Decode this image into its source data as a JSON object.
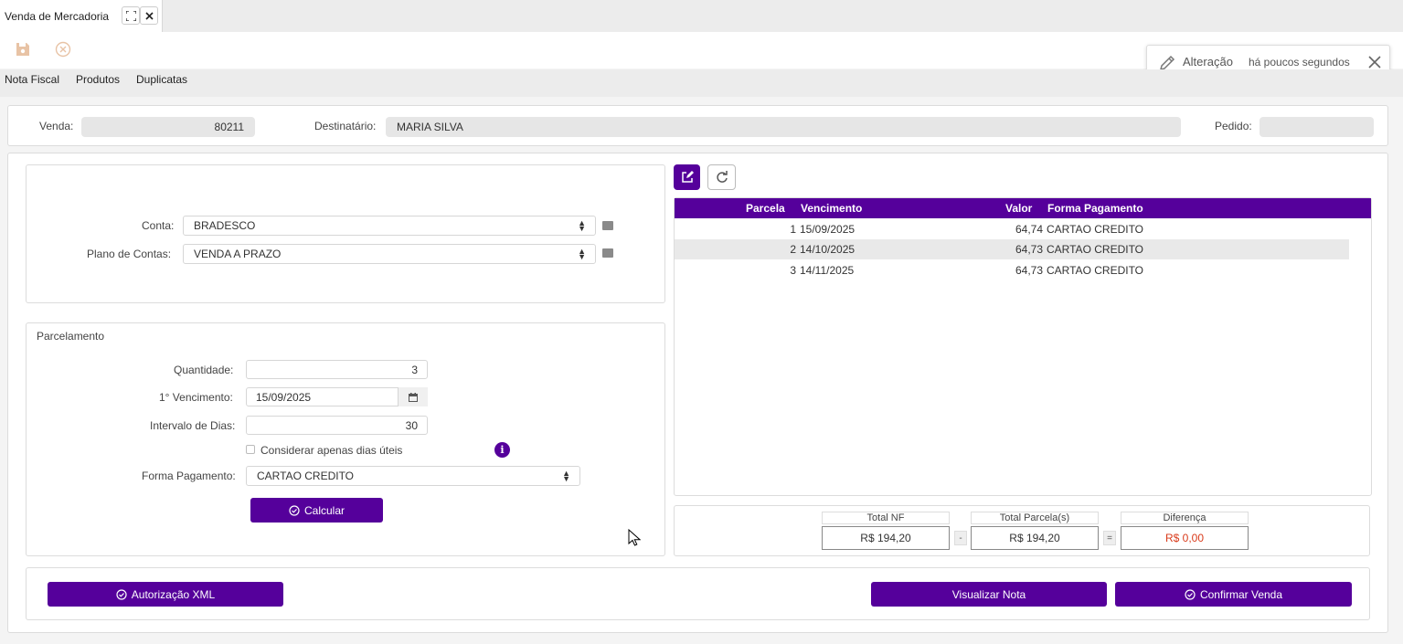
{
  "window": {
    "tab_title": "Venda de Mercadoria"
  },
  "toolbar": {
    "save_icon": "save-icon",
    "cancel_icon": "cancel-icon"
  },
  "menu": {
    "items": [
      "Nota Fiscal",
      "Produtos",
      "Duplicatas"
    ]
  },
  "toast": {
    "title": "Alteração",
    "subtitle": "há poucos segundos"
  },
  "header": {
    "venda_label": "Venda:",
    "venda_value": "80211",
    "destinatario_label": "Destinatário:",
    "destinatario_value": "MARIA SILVA",
    "pedido_label": "Pedido:",
    "pedido_value": ""
  },
  "account": {
    "conta_label": "Conta:",
    "conta_value": "BRADESCO",
    "plano_label": "Plano de Contas:",
    "plano_value": "VENDA A PRAZO"
  },
  "installments": {
    "section_title": "Parcelamento",
    "quantidade_label": "Quantidade:",
    "quantidade_value": "3",
    "vencimento_label": "1° Vencimento:",
    "vencimento_value": "15/09/2025",
    "intervalo_label": "Intervalo de Dias:",
    "intervalo_value": "30",
    "dias_uteis_label": "Considerar apenas dias úteis",
    "forma_label": "Forma Pagamento:",
    "forma_value": "CARTAO CREDITO",
    "calcular_label": "Calcular"
  },
  "grid": {
    "columns": [
      "Parcela",
      "Vencimento",
      "Valor",
      "Forma Pagamento"
    ],
    "rows": [
      {
        "parcela": "1",
        "vencimento": "15/09/2025",
        "valor": "64,74",
        "forma": "CARTAO CREDITO"
      },
      {
        "parcela": "2",
        "vencimento": "14/10/2025",
        "valor": "64,73",
        "forma": "CARTAO CREDITO"
      },
      {
        "parcela": "3",
        "vencimento": "14/11/2025",
        "valor": "64,73",
        "forma": "CARTAO CREDITO"
      }
    ]
  },
  "totals": {
    "total_nf_label": "Total NF",
    "total_nf_value": "R$ 194,20",
    "minus": "-",
    "total_parcelas_label": "Total Parcela(s)",
    "total_parcelas_value": "R$ 194,20",
    "equals": "=",
    "diferenca_label": "Diferença",
    "diferenca_value": "R$ 0,00"
  },
  "actions": {
    "autorizacao_label": "Autorização XML",
    "visualizar_label": "Visualizar Nota",
    "confirmar_label": "Confirmar Venda"
  },
  "colors": {
    "primary": "#55009b",
    "difference": "#d93a1a"
  }
}
